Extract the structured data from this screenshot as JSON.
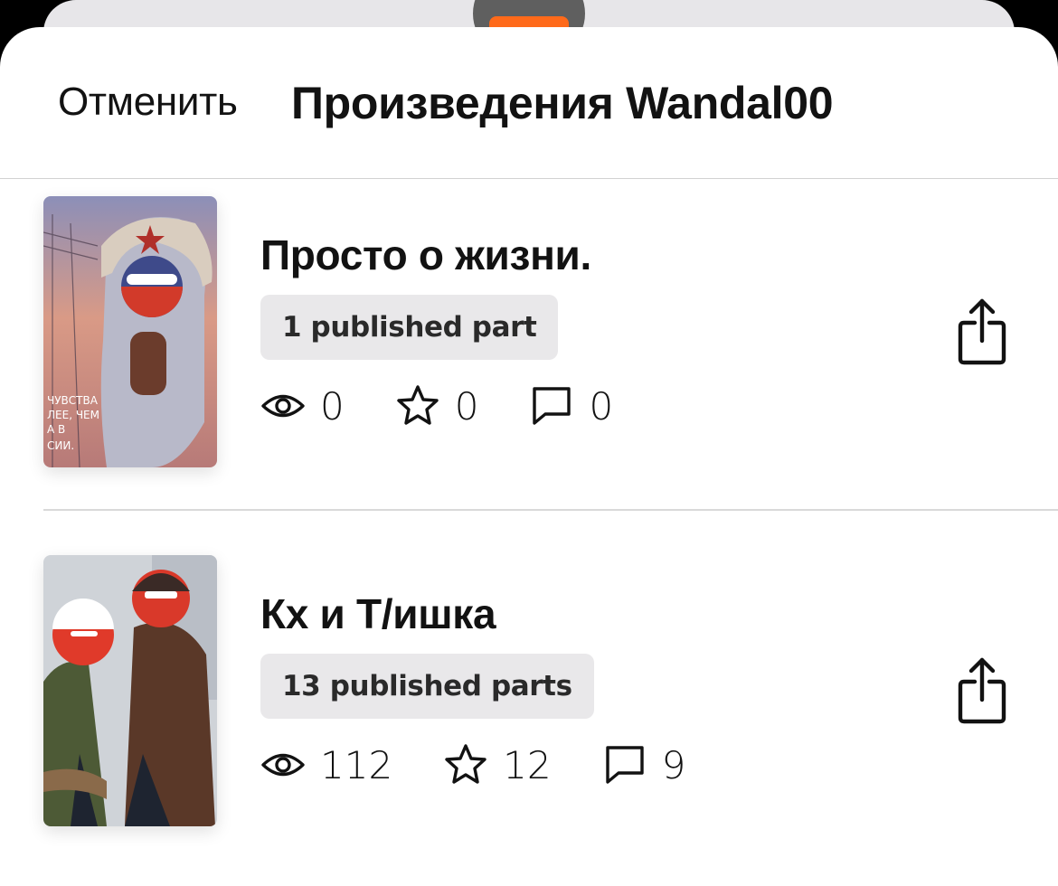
{
  "header": {
    "cancel_label": "Отменить",
    "title": "Произведения Wandal00"
  },
  "stories": [
    {
      "title": "Просто о жизни.",
      "parts": "1 published part",
      "views": "0",
      "votes": "0",
      "comments": "0",
      "cover_text": "ЧУВСТВА ... ЧЕМ ... В ... СИИ"
    },
    {
      "title": "Кх и Т/ишка",
      "parts": "13 published parts",
      "views": "112",
      "votes": "12",
      "comments": "9"
    }
  ],
  "icons": {
    "views": "eye-icon",
    "votes": "star-icon",
    "comments": "comment-icon",
    "share": "share-icon"
  },
  "colors": {
    "accent": "#ff6a1a",
    "chip_bg": "#e9e8ea",
    "text": "#121212"
  }
}
